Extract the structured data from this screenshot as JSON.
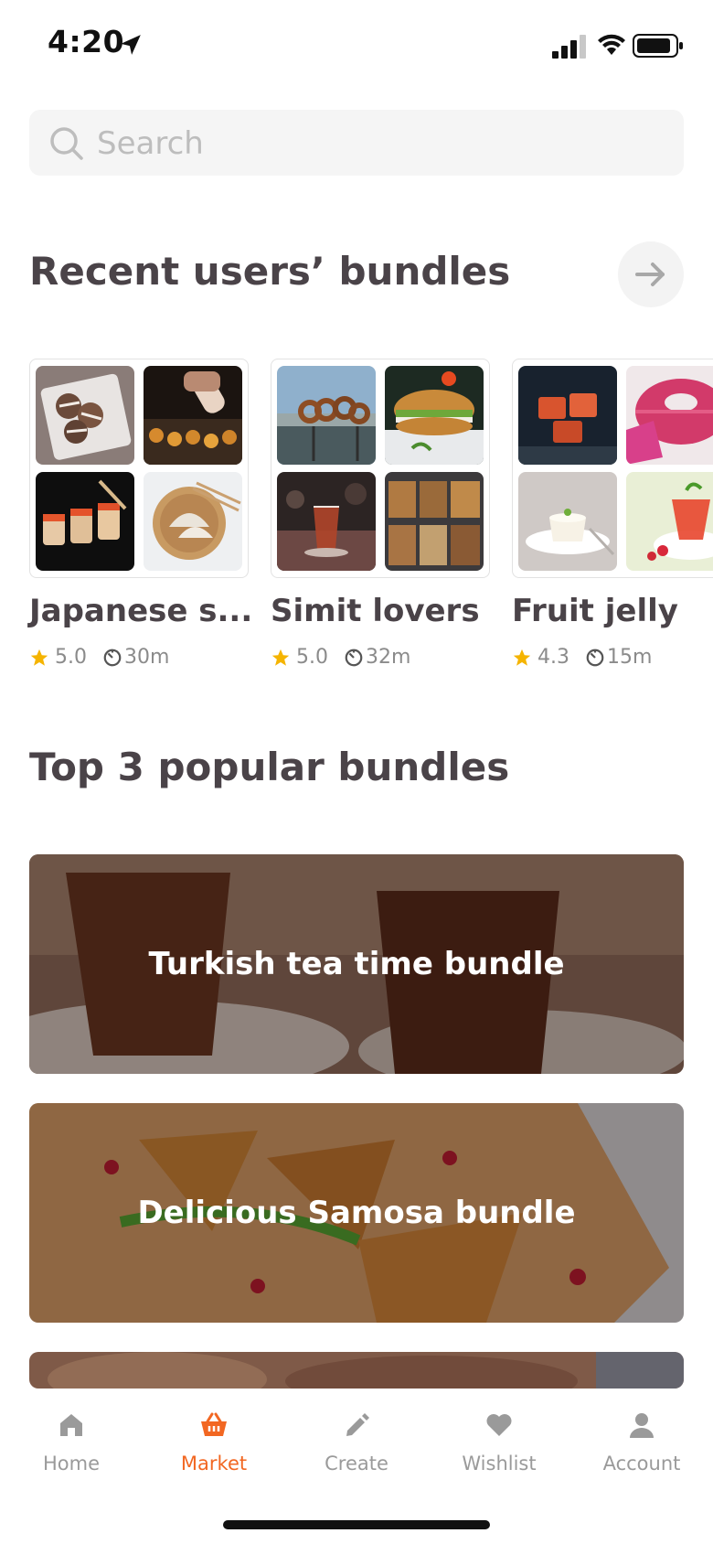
{
  "status_bar": {
    "time": "4:20"
  },
  "search": {
    "placeholder": "Search"
  },
  "recent": {
    "title": "Recent users’ bundles",
    "items": [
      {
        "name": "Japanese s...",
        "rating": "5.0",
        "duration": "30m"
      },
      {
        "name": "Simit lovers",
        "rating": "5.0",
        "duration": "32m"
      },
      {
        "name": "Fruit jelly",
        "rating": "4.3",
        "duration": "15m"
      }
    ]
  },
  "popular": {
    "title": "Top 3 popular bundles",
    "items": [
      {
        "label": "Turkish tea time bundle"
      },
      {
        "label": "Delicious Samosa bundle"
      },
      {
        "label": ""
      }
    ]
  },
  "tabbar": {
    "items": [
      {
        "label": "Home",
        "icon": "home-icon"
      },
      {
        "label": "Market",
        "icon": "basket-icon"
      },
      {
        "label": "Create",
        "icon": "pencil-icon"
      },
      {
        "label": "Wishlist",
        "icon": "heart-icon"
      },
      {
        "label": "Account",
        "icon": "user-icon"
      }
    ],
    "active": "Market"
  },
  "colors": {
    "accent": "#f26722",
    "star": "#f5b400",
    "title": "#4a4348",
    "muted": "#9a9a9a"
  }
}
